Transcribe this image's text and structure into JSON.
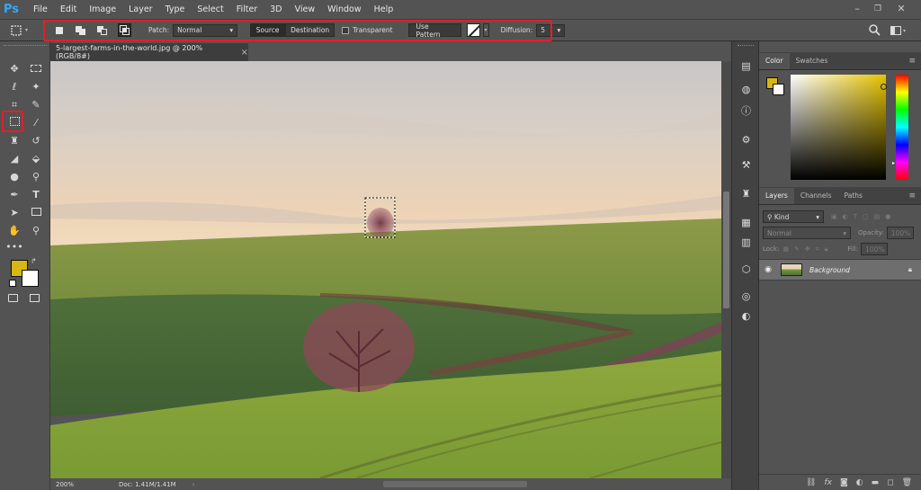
{
  "app": {
    "logo": "Ps"
  },
  "menu": [
    "File",
    "Edit",
    "Image",
    "Layer",
    "Type",
    "Select",
    "Filter",
    "3D",
    "View",
    "Window",
    "Help"
  ],
  "window_controls": {
    "minimize": "–",
    "restore": "❐",
    "close": "✕"
  },
  "options": {
    "patch_label": "Patch:",
    "patch_value": "Normal",
    "source_label": "Source",
    "destination_label": "Destination",
    "transparent_label": "Transparent",
    "use_pattern_label": "Use Pattern",
    "diffusion_label": "Diffusion:",
    "diffusion_value": "5"
  },
  "document": {
    "tab_title": "5-largest-farms-in-the-world.jpg @ 200% (RGB/8#)",
    "tab_close": "×"
  },
  "status": {
    "zoom": "200%",
    "doc": "Doc: 1.41M/1.41M",
    "arrow": "›"
  },
  "color_panel": {
    "tabs": [
      "Color",
      "Swatches"
    ],
    "foreground": "#d8b712",
    "background": "#ffffff"
  },
  "layers_panel": {
    "tabs": [
      "Layers",
      "Channels",
      "Paths"
    ],
    "kind_label": "Kind",
    "blend_mode": "Normal",
    "opacity_label": "Opacity:",
    "opacity_value": "100%",
    "lock_label": "Lock:",
    "fill_label": "Fill:",
    "fill_value": "100%",
    "layers": [
      {
        "name": "Background",
        "visible": true,
        "locked": true
      }
    ]
  },
  "colors": {
    "highlight": "#e0202a",
    "ui_bg": "#535353",
    "panel_dark": "#424242"
  }
}
